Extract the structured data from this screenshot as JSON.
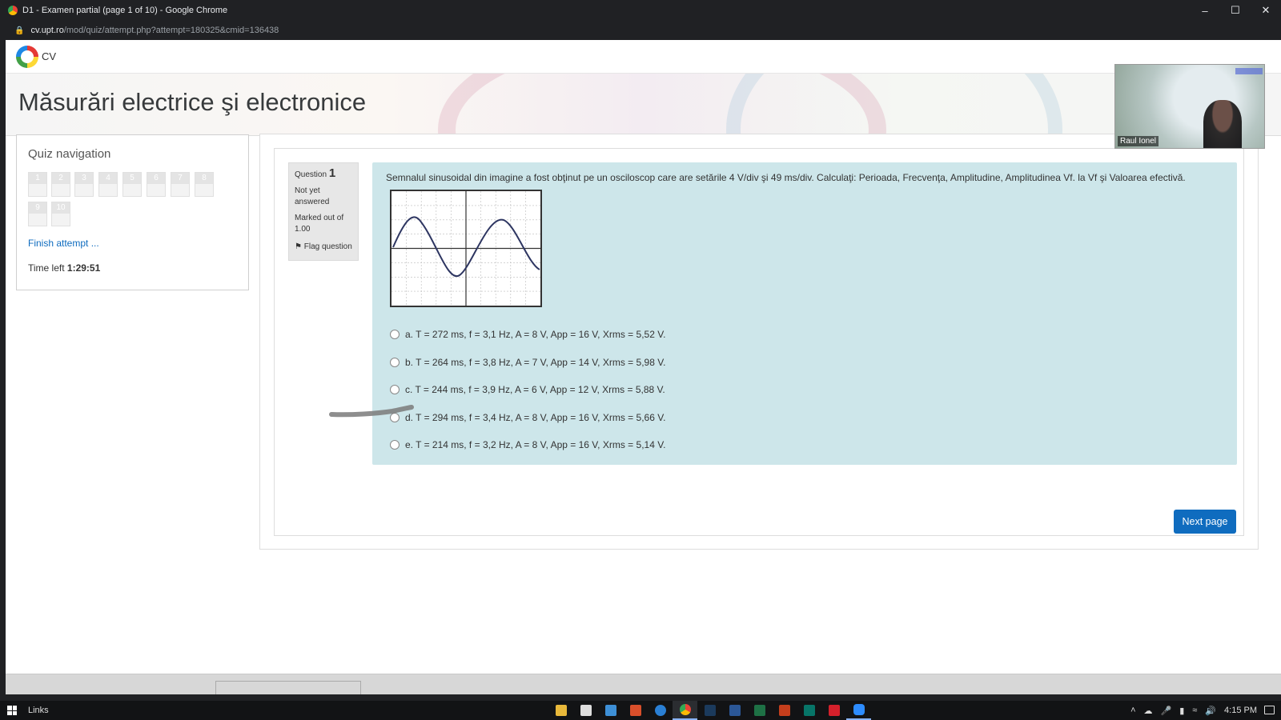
{
  "browser": {
    "window_title": "D1 - Examen partial (page 1 of 10) - Google Chrome",
    "url_domain": "cv.upt.ro",
    "url_path": "/mod/quiz/attempt.php?attempt=180325&cmid=136438"
  },
  "site": {
    "brand": "CV",
    "course_title": "Măsurări electrice şi electronice"
  },
  "video": {
    "participant_name": "Raul Ionel"
  },
  "quiz_nav": {
    "title": "Quiz navigation",
    "buttons": [
      "1",
      "2",
      "3",
      "4",
      "5",
      "6",
      "7",
      "8",
      "9",
      "10"
    ],
    "finish_link": "Finish attempt ...",
    "time_left_label": "Time left",
    "time_left_value": "1:29:51"
  },
  "question": {
    "label": "Question",
    "number": "1",
    "status": "Not yet answered",
    "marks": "Marked out of 1.00",
    "flag": "Flag question",
    "text": "Semnalul sinusoidal din imagine a fost obţinut pe un osciloscop care are setările 4 V/div şi 49 ms/div. Calculaţi: Perioada, Frecvenţa, Amplitudine, Amplitudinea Vf. la Vf şi Valoarea efectivă.",
    "answers": [
      "a. T = 272 ms, f = 3,1 Hz, A = 8 V, App = 16 V, Xrms = 5,52 V.",
      "b. T = 264 ms, f = 3,8 Hz, A = 7 V, App = 14 V, Xrms = 5,98 V.",
      "c. T = 244 ms, f = 3,9 Hz, A = 6 V, App = 12 V, Xrms = 5,88 V.",
      "d. T = 294 ms, f = 3,4 Hz, A = 8 V, App = 16 V, Xrms = 5,66 V.",
      "e. T = 214 ms, f = 3,2 Hz, A = 8 V, App = 16 V, Xrms = 5,14 V."
    ],
    "next_button": "Next page"
  },
  "taskbar": {
    "links_label": "Links",
    "clock": "4:15 PM"
  }
}
